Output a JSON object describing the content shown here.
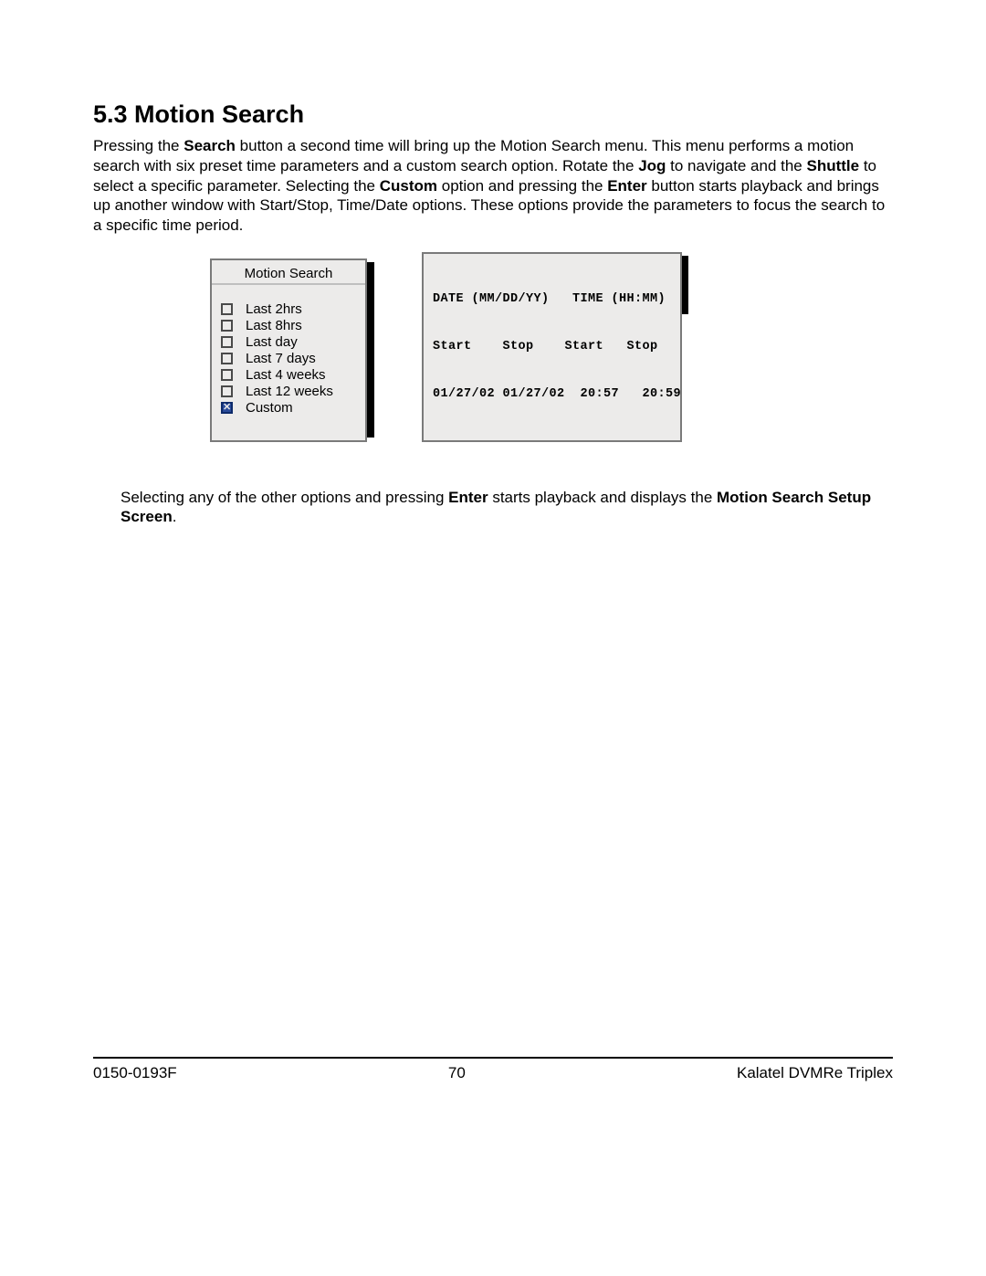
{
  "heading": "5.3  Motion Search",
  "para1_parts": {
    "t1": "Pressing the ",
    "b1": "Search",
    "t2": " button a second time will bring up the Motion Search menu. This menu performs a motion search with six preset time parameters and a custom search option. Rotate the ",
    "b2": "Jog",
    "t3": " to navigate and the ",
    "b3": "Shuttle",
    "t4": " to select a specific parameter. Selecting the ",
    "b4": "Custom",
    "t5": " option and pressing the ",
    "b5": "Enter",
    "t6": " button starts playback and brings up another window with Start/Stop, Time/Date options. These options provide the parameters to focus the search to a specific time period."
  },
  "menu": {
    "title": "Motion Search",
    "items": [
      {
        "label": "Last 2hrs",
        "selected": false
      },
      {
        "label": "Last 8hrs",
        "selected": false
      },
      {
        "label": "Last day",
        "selected": false
      },
      {
        "label": "Last 7 days",
        "selected": false
      },
      {
        "label": "Last 4 weeks",
        "selected": false
      },
      {
        "label": "Last 12 weeks",
        "selected": false
      },
      {
        "label": "Custom",
        "selected": true
      }
    ]
  },
  "datetime": {
    "row1": "DATE (MM/DD/YY)   TIME (HH:MM)",
    "row2": "Start    Stop    Start   Stop",
    "row3": "01/27/02 01/27/02  20:57   20:59"
  },
  "para2_parts": {
    "t1": "Selecting any of the other options and pressing ",
    "b1": "Enter",
    "t2": " starts playback and displays the ",
    "b2": "Motion Search Setup Screen",
    "t3": "."
  },
  "footer": {
    "left": "0150-0193F",
    "center": "70",
    "right": "Kalatel DVMRe Triplex"
  }
}
